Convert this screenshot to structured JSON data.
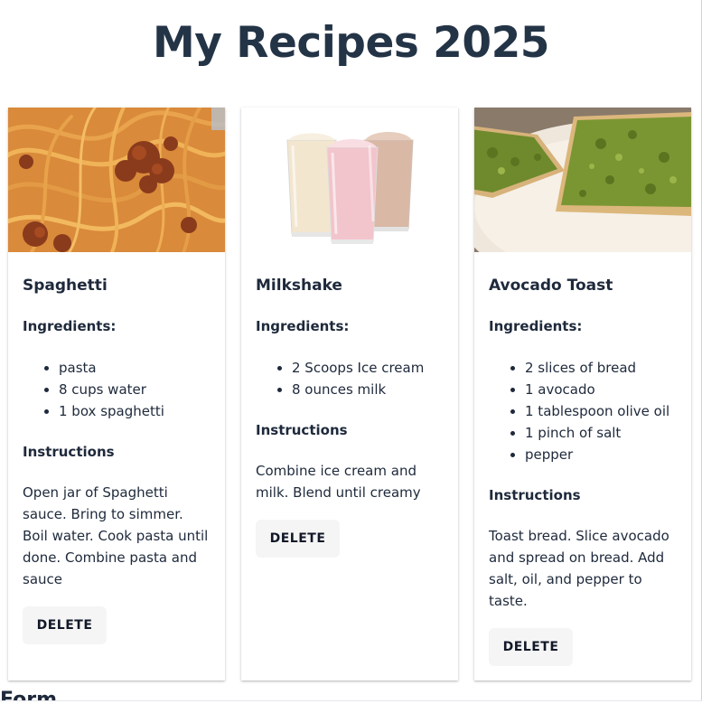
{
  "page": {
    "title": "My Recipes 2025"
  },
  "recipes": [
    {
      "name": "Spaghetti",
      "ingredients_label": "Ingredients:",
      "ingredients": [
        "pasta",
        "8 cups water",
        "1 box spaghetti"
      ],
      "instructions_label": "Instructions",
      "instructions": "Open jar of Spaghetti sauce. Bring to simmer. Boil water. Cook pasta until done. Combine pasta and sauce",
      "delete_label": "DELETE"
    },
    {
      "name": "Milkshake",
      "ingredients_label": "Ingredients:",
      "ingredients": [
        "2 Scoops Ice cream",
        "8 ounces milk"
      ],
      "instructions_label": "Instructions",
      "instructions": "Combine ice cream and milk. Blend until creamy",
      "delete_label": "DELETE"
    },
    {
      "name": "Avocado Toast",
      "ingredients_label": "Ingredients:",
      "ingredients": [
        "2 slices of bread",
        "1 avocado",
        "1 tablespoon olive oil",
        "1 pinch of salt",
        "pepper"
      ],
      "instructions_label": "Instructions",
      "instructions": "Toast bread. Slice avocado and spread on bread. Add salt, oil, and pepper to taste.",
      "delete_label": "DELETE"
    }
  ],
  "form": {
    "heading": "Form"
  }
}
